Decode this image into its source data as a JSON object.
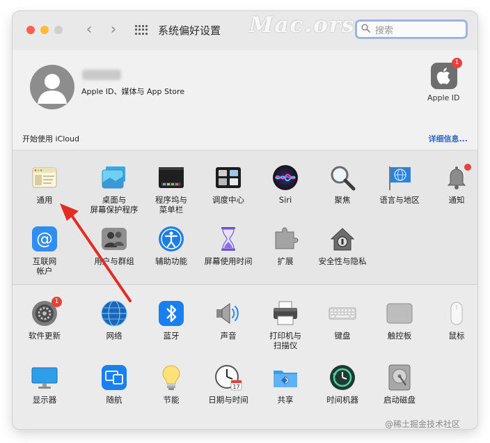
{
  "window": {
    "title": "系统偏好设置",
    "watermark": "Mac.orsoon.com",
    "search_placeholder": "搜索"
  },
  "user": {
    "subtitle": "Apple ID、媒体与 App Store",
    "apple_id_label": "Apple ID",
    "apple_id_badge": "1"
  },
  "icloud": {
    "prompt": "开始使用 iCloud",
    "details_link": "详细信息..."
  },
  "prefs_row1": [
    "通用",
    "桌面与\n屏幕保护程序",
    "程序坞与\n菜单栏",
    "调度中心",
    "Siri",
    "聚焦",
    "语言与地区",
    "通知"
  ],
  "prefs_row2": [
    "互联网\n帐户",
    "用户与群组",
    "辅助功能",
    "屏幕使用时间",
    "扩展",
    "安全性与隐私"
  ],
  "prefs_row3": [
    "软件更新",
    "网络",
    "蓝牙",
    "声音",
    "打印机与\n扫描仪",
    "键盘",
    "触控板",
    "鼠标"
  ],
  "prefs_row4": [
    "显示器",
    "随航",
    "节能",
    "日期与时间",
    "共享",
    "时间机器",
    "启动磁盘"
  ],
  "software_update_badge": "1",
  "date_icon_day": "17",
  "footer_watermark": "@稀土掘金技术社区",
  "colors": {
    "red": "#fe5f57",
    "yellow": "#febc2e",
    "accent_link": "#2d66c4",
    "badge": "#e8413a",
    "annotation_arrow": "#e32c24"
  }
}
